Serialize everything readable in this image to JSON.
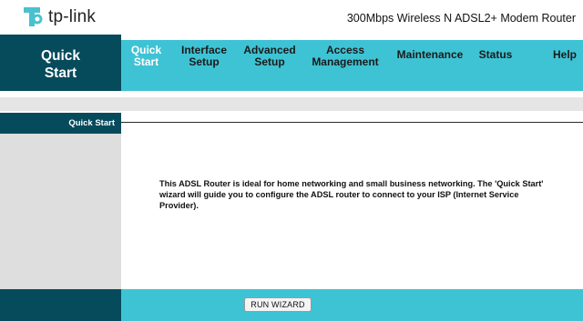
{
  "brand": {
    "logo_text": "tp-link",
    "logo_color": "#4ac1cf"
  },
  "header": {
    "product_title": "300Mbps Wireless N ADSL2+ Modem Router"
  },
  "nav": {
    "section_title": "Quick\nStart",
    "tabs": [
      {
        "label": "Quick\nStart",
        "active": true
      },
      {
        "label": "Interface\nSetup",
        "active": false
      },
      {
        "label": "Advanced\nSetup",
        "active": false
      },
      {
        "label": "Access\nManagement",
        "active": false
      },
      {
        "label": "Maintenance",
        "active": false
      },
      {
        "label": "Status",
        "active": false
      },
      {
        "label": "Help",
        "active": false
      }
    ]
  },
  "sidebar": {
    "section_label": "Quick Start"
  },
  "content": {
    "description": "This ADSL Router is ideal for home networking and small business networking. The 'Quick Start' wizard will guide you to configure the ADSL router to connect to your ISP (Internet Service Provider)."
  },
  "footer": {
    "run_wizard_label": "RUN WIZARD"
  },
  "colors": {
    "dark_teal": "#064b5c",
    "accent_cyan": "#3ec3d4",
    "sidebar_gray": "#dedede"
  }
}
